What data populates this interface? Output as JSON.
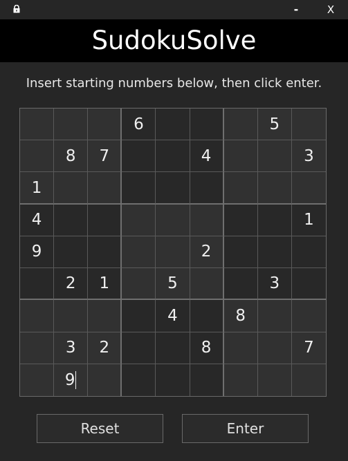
{
  "window": {
    "lock_icon": "lock-icon",
    "minimize_label": "-",
    "close_label": "X"
  },
  "app": {
    "title": "SudokuSolve",
    "instruction": "Insert starting numbers below, then click enter."
  },
  "board": {
    "rows": [
      [
        "",
        "",
        "",
        "6",
        "",
        "",
        "",
        "5",
        ""
      ],
      [
        "",
        "8",
        "7",
        "",
        "",
        "4",
        "",
        "",
        "3"
      ],
      [
        "1",
        "",
        "",
        "",
        "",
        "",
        "",
        "",
        ""
      ],
      [
        "4",
        "",
        "",
        "",
        "",
        "",
        "",
        "",
        "1"
      ],
      [
        "9",
        "",
        "",
        "",
        "",
        "2",
        "",
        "",
        ""
      ],
      [
        "",
        "2",
        "1",
        "",
        "5",
        "",
        "",
        "3",
        ""
      ],
      [
        "",
        "",
        "",
        "",
        "4",
        "",
        "8",
        "",
        ""
      ],
      [
        "",
        "3",
        "2",
        "",
        "",
        "8",
        "",
        "",
        "7"
      ],
      [
        "",
        "9",
        "",
        "",
        "",
        "",
        "",
        "",
        ""
      ]
    ],
    "focused_cell": {
      "row": 8,
      "col": 1
    }
  },
  "buttons": {
    "reset_label": "Reset",
    "enter_label": "Enter"
  }
}
